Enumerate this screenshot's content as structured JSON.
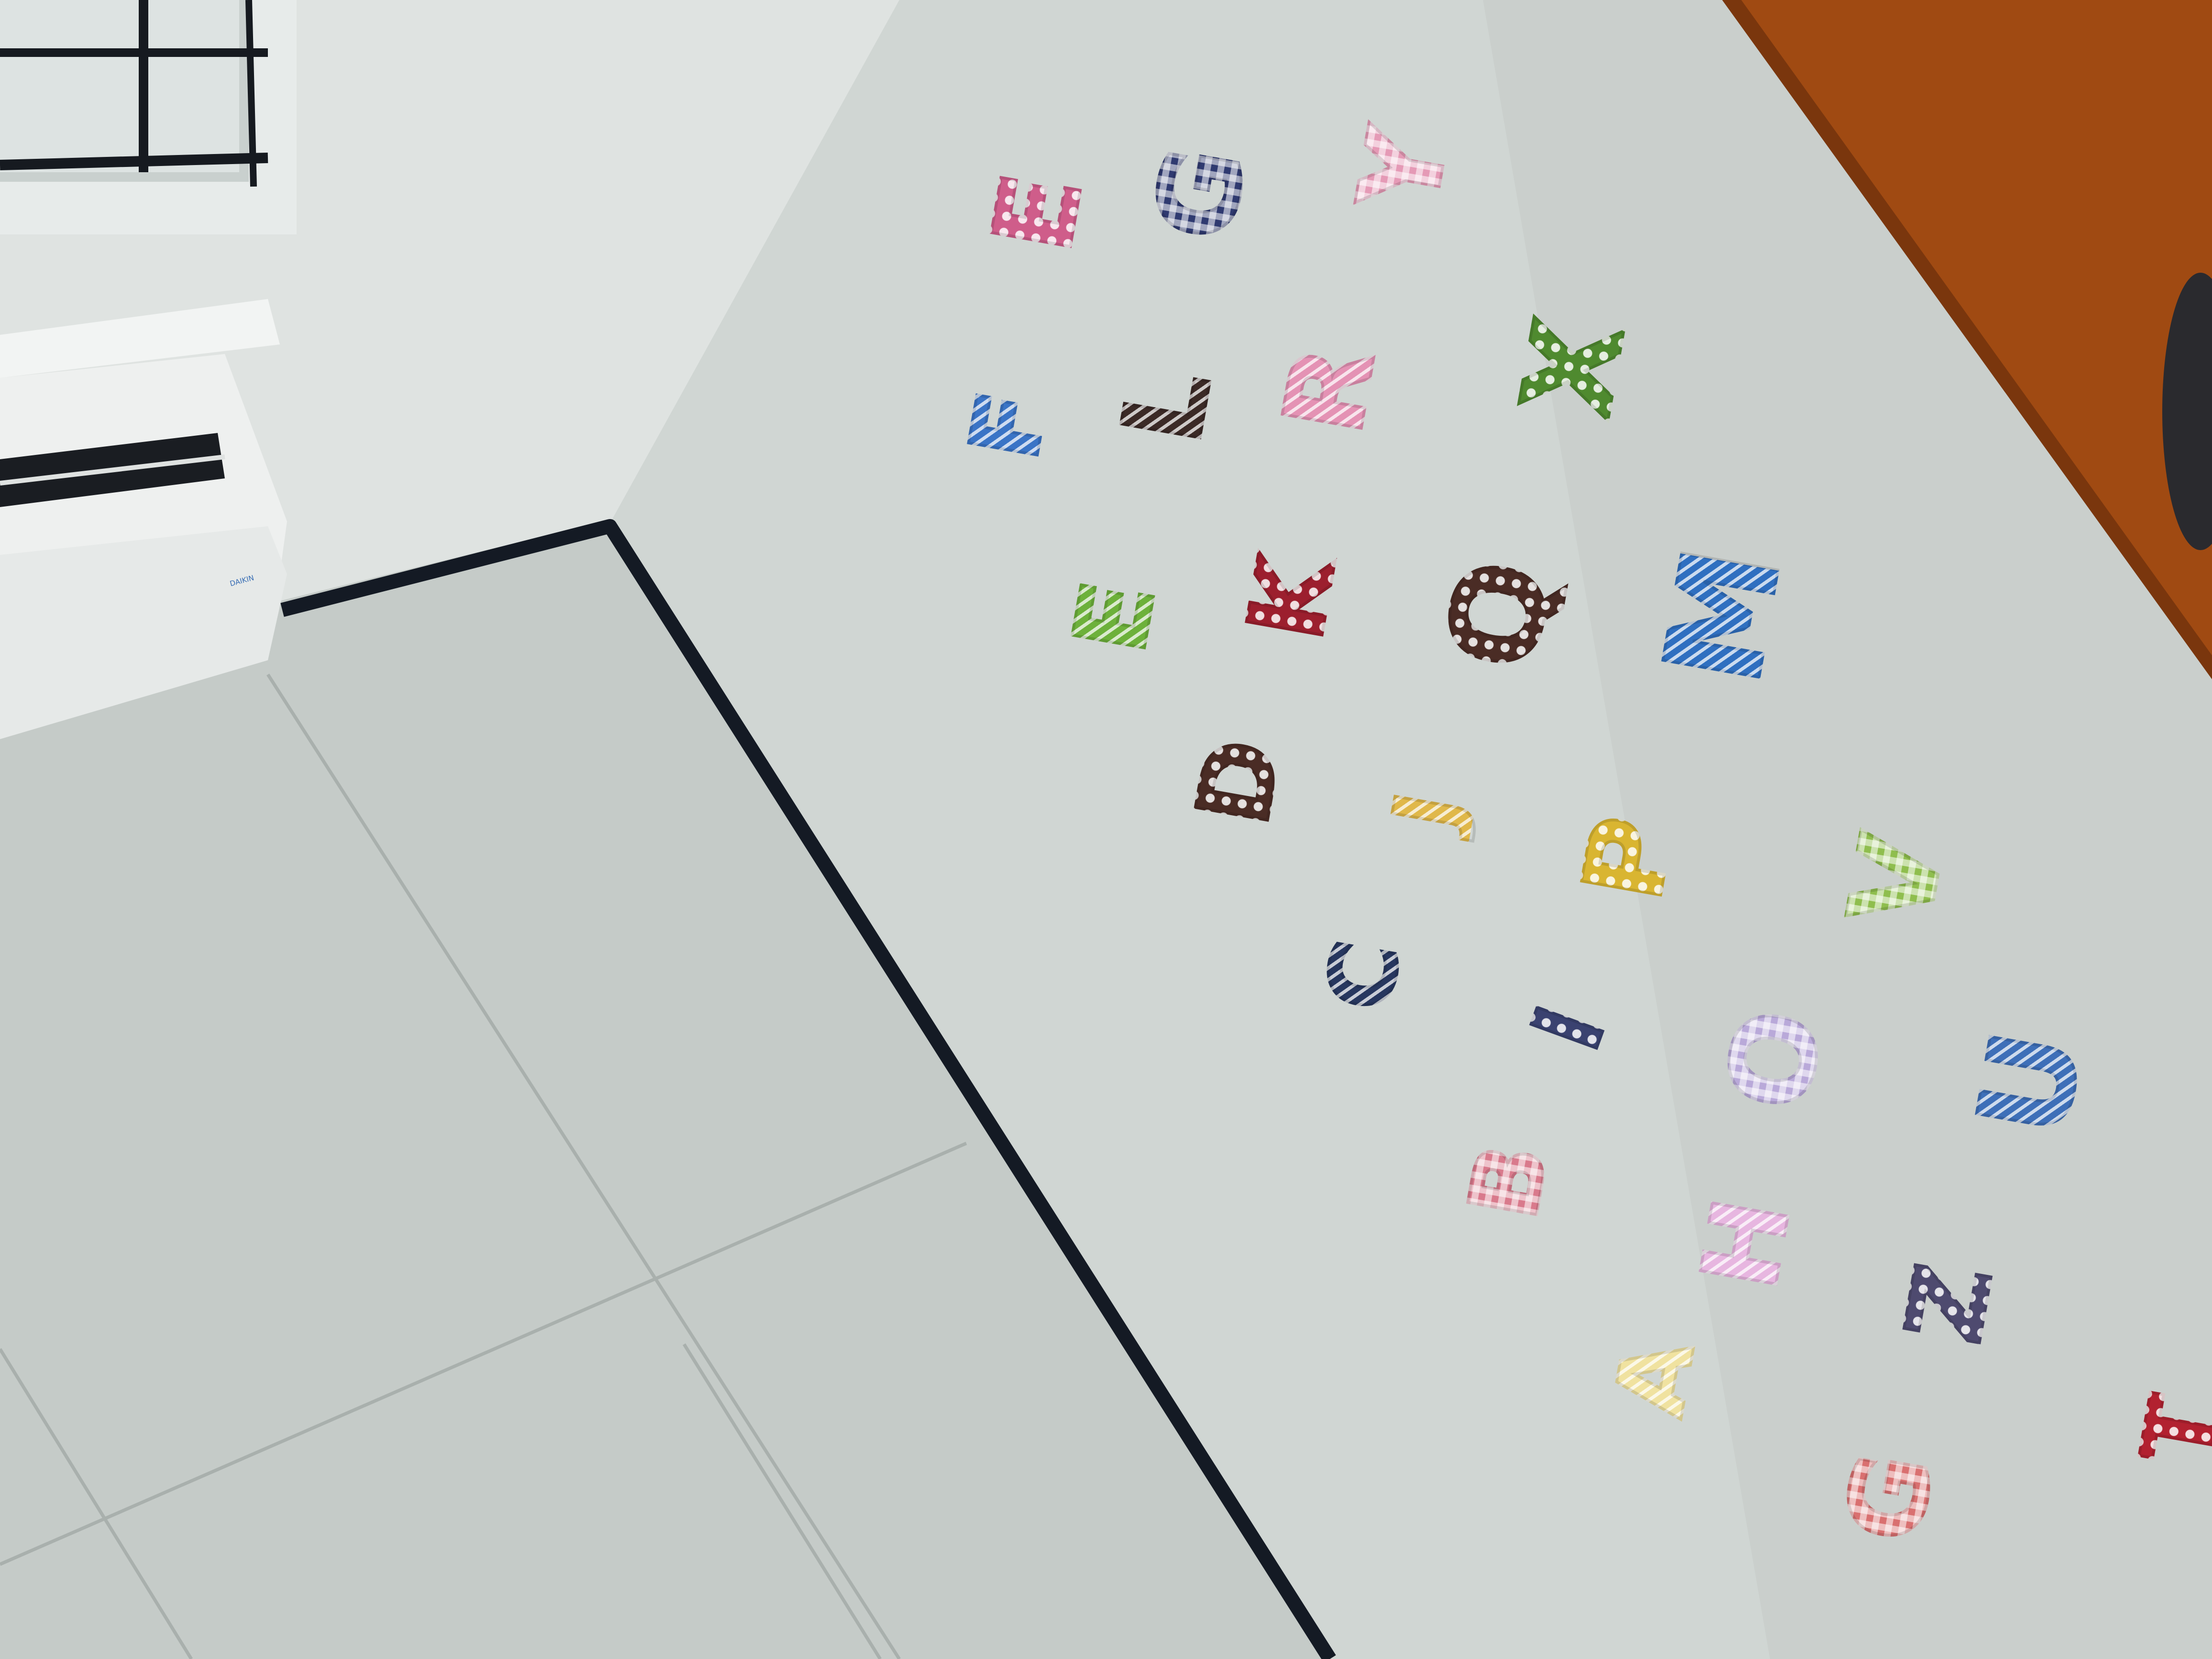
{
  "scene": {
    "colors": {
      "wall": "#d0d6d3",
      "upper_wall": "#dfe3e1",
      "floor": "#c5cbc8",
      "baseboard": "#141a24",
      "wood": "#a04a12",
      "ac_body": "#eef0ef"
    },
    "air_conditioner": {
      "brand_text": "DAIKIN"
    },
    "letters": [
      {
        "char": "E",
        "color": "#cf5d8a",
        "pattern": "dots"
      },
      {
        "char": "G",
        "color": "#2f3a70",
        "pattern": "check"
      },
      {
        "char": "Y",
        "color": "#e59ab6",
        "pattern": "check"
      },
      {
        "char": "F",
        "color": "#3a74c6",
        "pattern": "stripes"
      },
      {
        "char": "L",
        "color": "#3b2a26",
        "pattern": "stripes"
      },
      {
        "char": "R",
        "color": "#e492b4",
        "pattern": "stripes"
      },
      {
        "char": "X",
        "color": "#4f8a2f",
        "pattern": "dots"
      },
      {
        "char": "E",
        "color": "#6db13b",
        "pattern": "stripes"
      },
      {
        "char": "K",
        "color": "#9c1f2e",
        "pattern": "dots"
      },
      {
        "char": "Q",
        "color": "#4a2c25",
        "pattern": "dots"
      },
      {
        "char": "M",
        "color": "#2f6fc0",
        "pattern": "stripes"
      },
      {
        "char": "D",
        "color": "#4a2c25",
        "pattern": "dots"
      },
      {
        "char": "J",
        "color": "#e0b84a",
        "pattern": "stripes"
      },
      {
        "char": "P",
        "color": "#d9b531",
        "pattern": "dots"
      },
      {
        "char": "V",
        "color": "#8fbe4e",
        "pattern": "check"
      },
      {
        "char": "C",
        "color": "#27375f",
        "pattern": "stripes"
      },
      {
        "char": "I",
        "color": "#3a4270",
        "pattern": "dots"
      },
      {
        "char": "O",
        "color": "#b9a9d9",
        "pattern": "check"
      },
      {
        "char": "U",
        "color": "#3e6fb8",
        "pattern": "stripes"
      },
      {
        "char": "B",
        "color": "#d97a8c",
        "pattern": "check"
      },
      {
        "char": "H",
        "color": "#e7b6e0",
        "pattern": "stripes"
      },
      {
        "char": "Z",
        "color": "#4e4a6f",
        "pattern": "dots"
      },
      {
        "char": "A",
        "color": "#f0e2a0",
        "pattern": "stripes"
      },
      {
        "char": "G",
        "color": "#d97070",
        "pattern": "check"
      },
      {
        "char": "T",
        "color": "#b22130",
        "pattern": "dots"
      }
    ]
  }
}
